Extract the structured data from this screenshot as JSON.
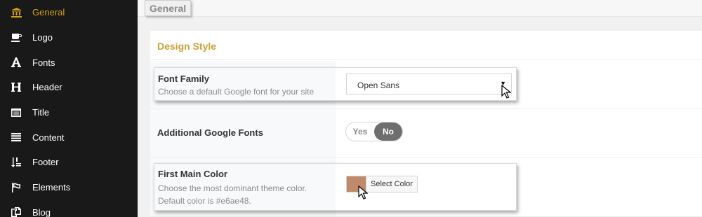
{
  "sidebar": {
    "items": [
      {
        "label": "General",
        "icon": "bank-icon",
        "active": true
      },
      {
        "label": "Logo",
        "icon": "cup-icon"
      },
      {
        "label": "Fonts",
        "icon": "font-icon"
      },
      {
        "label": "Header",
        "icon": "header-icon"
      },
      {
        "label": "Title",
        "icon": "window-icon"
      },
      {
        "label": "Content",
        "icon": "align-justify-icon"
      },
      {
        "label": "Footer",
        "icon": "sort-list-icon"
      },
      {
        "label": "Elements",
        "icon": "flag-icon"
      },
      {
        "label": "Blog",
        "icon": "copy-icon"
      }
    ]
  },
  "page": {
    "title": "General",
    "section_title": "Design Style"
  },
  "fields": {
    "font_family": {
      "title": "Font Family",
      "desc": "Choose a default Google font for your site",
      "value": "Open Sans"
    },
    "additional_fonts": {
      "title": "Additional Google Fonts",
      "yes_label": "Yes",
      "no_label": "No",
      "selected": "No"
    },
    "main_color": {
      "title": "First Main Color",
      "desc_line1": "Choose the most dominant theme color.",
      "desc_line2": "Default color is #e6ae48.",
      "button_label": "Select Color",
      "swatch_color": "#c08a6a"
    }
  },
  "colors": {
    "sidebar_bg": "#191919",
    "accent": "#d4a017",
    "section_title": "#c9a137"
  }
}
